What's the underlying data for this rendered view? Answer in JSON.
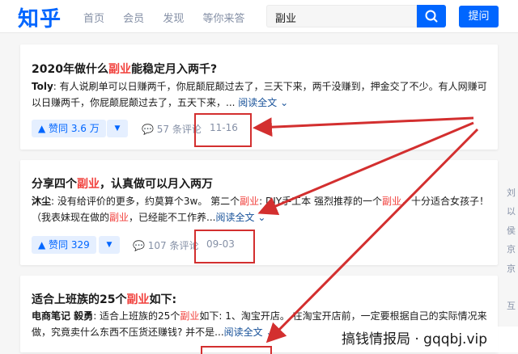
{
  "header": {
    "logo": "知乎",
    "nav": [
      "首页",
      "会员",
      "发现",
      "等你来答"
    ],
    "search_value": "副业",
    "search_icon": "search-icon",
    "ask_label": "提问"
  },
  "results": [
    {
      "title_pre": "2020年做什么",
      "title_hl": "副业",
      "title_post": "能稳定月入两千?",
      "author": "Toly",
      "excerpt": ": 有人说刷单可以日赚两千，你屁颠屁颠过去了，三天下来，两千没赚到，押金交了不少。有人网赚可以日赚两千，你屁颠屁颠过去了，五天下来，...",
      "read_more": "阅读全文",
      "vote": "赞同 3.6 万",
      "comments": "57 条评论",
      "date": "11-16"
    },
    {
      "title_pre": "分享四个",
      "title_hl": "副业",
      "title_post": "，认真做可以月入两万",
      "author": "沐尘",
      "excerpt_a": ": 没有给评价的更多，约莫算个3w。 第二个",
      "excerpt_hl": "副业",
      "excerpt_b": ": DIY手工本 强烈推荐的一个",
      "excerpt_hl2": "副业",
      "excerpt_c": "，十分适合女孩子！（我表妹现在做的",
      "excerpt_hl3": "副业",
      "excerpt_d": "，已经能不工作养...",
      "read_more": "阅读全文",
      "vote": "赞同 329",
      "comments": "107 条评论",
      "date": "09-03"
    },
    {
      "title_pre": "适合上班族的25个",
      "title_hl": "副业",
      "title_post": "如下:",
      "author": "电商笔记 毅勇",
      "excerpt_a": ": 适合上班族的25个",
      "excerpt_hl": "副业",
      "excerpt_b": "如下: 1、淘宝开店。 在淘宝开店前，一定要根据自己的实际情况来做，究竟卖什么东西不压货还赚钱? 并不是...",
      "read_more": "阅读全文"
    }
  ],
  "right_sidebar_chars": [
    "刘",
    "以",
    "侯",
    "京",
    "京",
    "互"
  ],
  "watermark": "搞钱情报局 · gqqbj.vip",
  "colors": {
    "brand": "#0066ff",
    "highlight": "#f1403c",
    "annotation": "#d32f2f"
  }
}
